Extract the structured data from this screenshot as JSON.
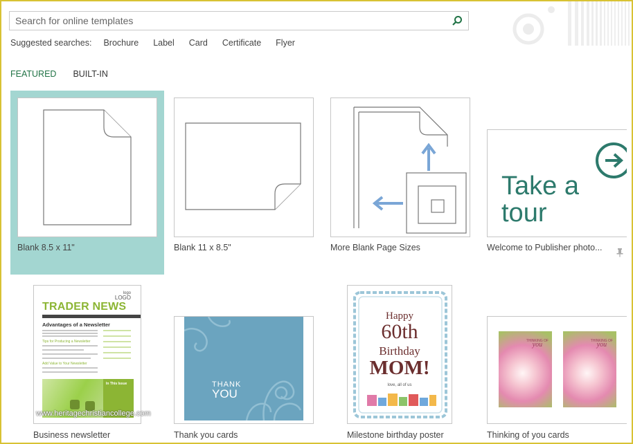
{
  "search": {
    "placeholder": "Search for online templates",
    "icon": "search-icon"
  },
  "suggested": {
    "label": "Suggested searches:",
    "links": [
      "Brochure",
      "Label",
      "Card",
      "Certificate",
      "Flyer"
    ]
  },
  "tabs": [
    {
      "label": "FEATURED",
      "active": true
    },
    {
      "label": "BUILT-IN",
      "active": false
    }
  ],
  "templates": [
    {
      "caption": "Blank 8.5 x 11\""
    },
    {
      "caption": "Blank 11 x 8.5\""
    },
    {
      "caption": "More Blank Page Sizes"
    },
    {
      "caption": "Welcome to Publisher photo...",
      "thumb_text_line1": "Take a",
      "thumb_text_line2": "tour"
    },
    {
      "caption": "Business newsletter",
      "thumb": {
        "logo_line1": "logo",
        "logo_line2": "LOGO",
        "title": "TRADER NEWS",
        "headline": "Advantages of a Newsletter",
        "tip1": "Tips for Producing a Newsletter",
        "tip2": "Add Value to Your Newsletter",
        "sidebar": "In This Issue"
      }
    },
    {
      "caption": "Thank you cards",
      "thumb": {
        "line1": "THANK",
        "line2": "YOU"
      }
    },
    {
      "caption": "Milestone birthday poster",
      "thumb": {
        "happy": "Happy",
        "number": "60th",
        "birthday": "Birthday",
        "mom": "MOM!",
        "love": "love, all of us"
      }
    },
    {
      "caption": "Thinking of you cards",
      "thumb": {
        "small": "THINKING OF",
        "script": "you"
      }
    }
  ],
  "watermark": "www.heritagechristiancollege.com",
  "colors": {
    "accent": "#217346",
    "selected_bg": "#a3d6d1",
    "tour_teal": "#2d7a6c",
    "arrow_blue": "#7aa6d6",
    "frame_border": "#d8c233"
  }
}
